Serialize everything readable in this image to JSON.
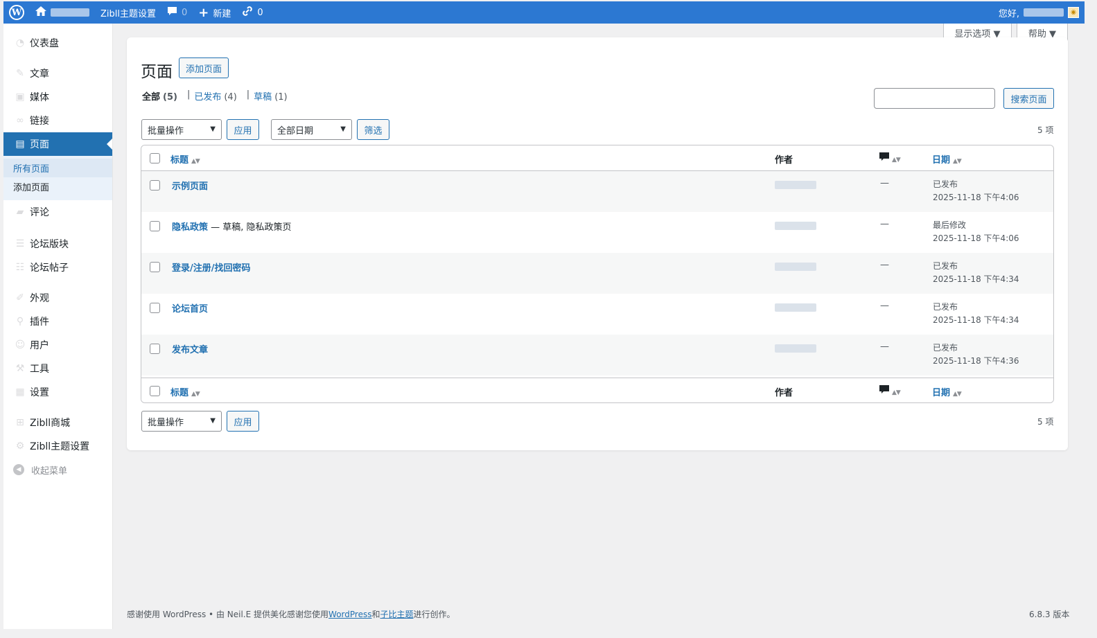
{
  "adminbar": {
    "site_settings": "Zibll主题设置",
    "comments_count": "0",
    "new_label": "新建",
    "links_count": "0",
    "greeting": "您好,"
  },
  "sidebar": {
    "items": [
      {
        "label": "仪表盘",
        "icon": "dashboard-icon"
      },
      {
        "label": "文章",
        "icon": "pin-icon"
      },
      {
        "label": "媒体",
        "icon": "media-icon"
      },
      {
        "label": "链接",
        "icon": "link-icon"
      },
      {
        "label": "页面",
        "icon": "pages-icon"
      },
      {
        "label": "评论",
        "icon": "comment-icon"
      },
      {
        "label": "论坛版块",
        "icon": "forum-icon"
      },
      {
        "label": "论坛帖子",
        "icon": "forum-post-icon"
      },
      {
        "label": "外观",
        "icon": "appearance-icon"
      },
      {
        "label": "插件",
        "icon": "plugin-icon"
      },
      {
        "label": "用户",
        "icon": "users-icon"
      },
      {
        "label": "工具",
        "icon": "tools-icon"
      },
      {
        "label": "设置",
        "icon": "settings-icon"
      },
      {
        "label": "Zibll商城",
        "icon": "shop-icon"
      },
      {
        "label": "Zibll主题设置",
        "icon": "theme-settings-icon"
      }
    ],
    "submenu": [
      "所有页面",
      "添加页面"
    ],
    "collapse_label": "收起菜单"
  },
  "screen_meta": {
    "options_label": "显示选项 ▼",
    "help_label": "帮助 ▼"
  },
  "main": {
    "title": "页面",
    "add_new": "添加页面",
    "filters": [
      {
        "label": "全部",
        "count": "(5)"
      },
      {
        "label": "已发布",
        "count": "(4)"
      },
      {
        "label": "草稿",
        "count": "(1)"
      }
    ],
    "search_button": "搜索页面",
    "bulk_action": "批量操作",
    "apply": "应用",
    "date_filter": "全部日期",
    "filter_button": "筛选",
    "item_count": "5 项",
    "columns": {
      "title": "标题",
      "author": "作者",
      "date": "日期"
    },
    "rows": [
      {
        "title": "示例页面",
        "state": "",
        "dash": "—",
        "status": "已发布",
        "date": "2025-11-18 下午4:06"
      },
      {
        "title": "隐私政策",
        "state": " — 草稿, 隐私政策页",
        "dash": "—",
        "status": "最后修改",
        "date": "2025-11-18 下午4:06"
      },
      {
        "title": "登录/注册/找回密码",
        "state": "",
        "dash": "—",
        "status": "已发布",
        "date": "2025-11-18 下午4:34"
      },
      {
        "title": "论坛首页",
        "state": "",
        "dash": "—",
        "status": "已发布",
        "date": "2025-11-18 下午4:34"
      },
      {
        "title": "发布文章",
        "state": "",
        "dash": "—",
        "status": "已发布",
        "date": "2025-11-18 下午4:36"
      }
    ]
  },
  "footer": {
    "prefix": "感谢使用 WordPress • 由 ",
    "author": "Neil.E",
    "middle": " 提供美化感谢您使用",
    "link1": "WordPress",
    "and": "和",
    "link2": "子比主题",
    "suffix": "进行创作。",
    "version": "6.8.3 版本"
  },
  "colors": {
    "adminbar": "#2c78d2",
    "accent": "#2271b1",
    "background": "#f0f0f1"
  }
}
